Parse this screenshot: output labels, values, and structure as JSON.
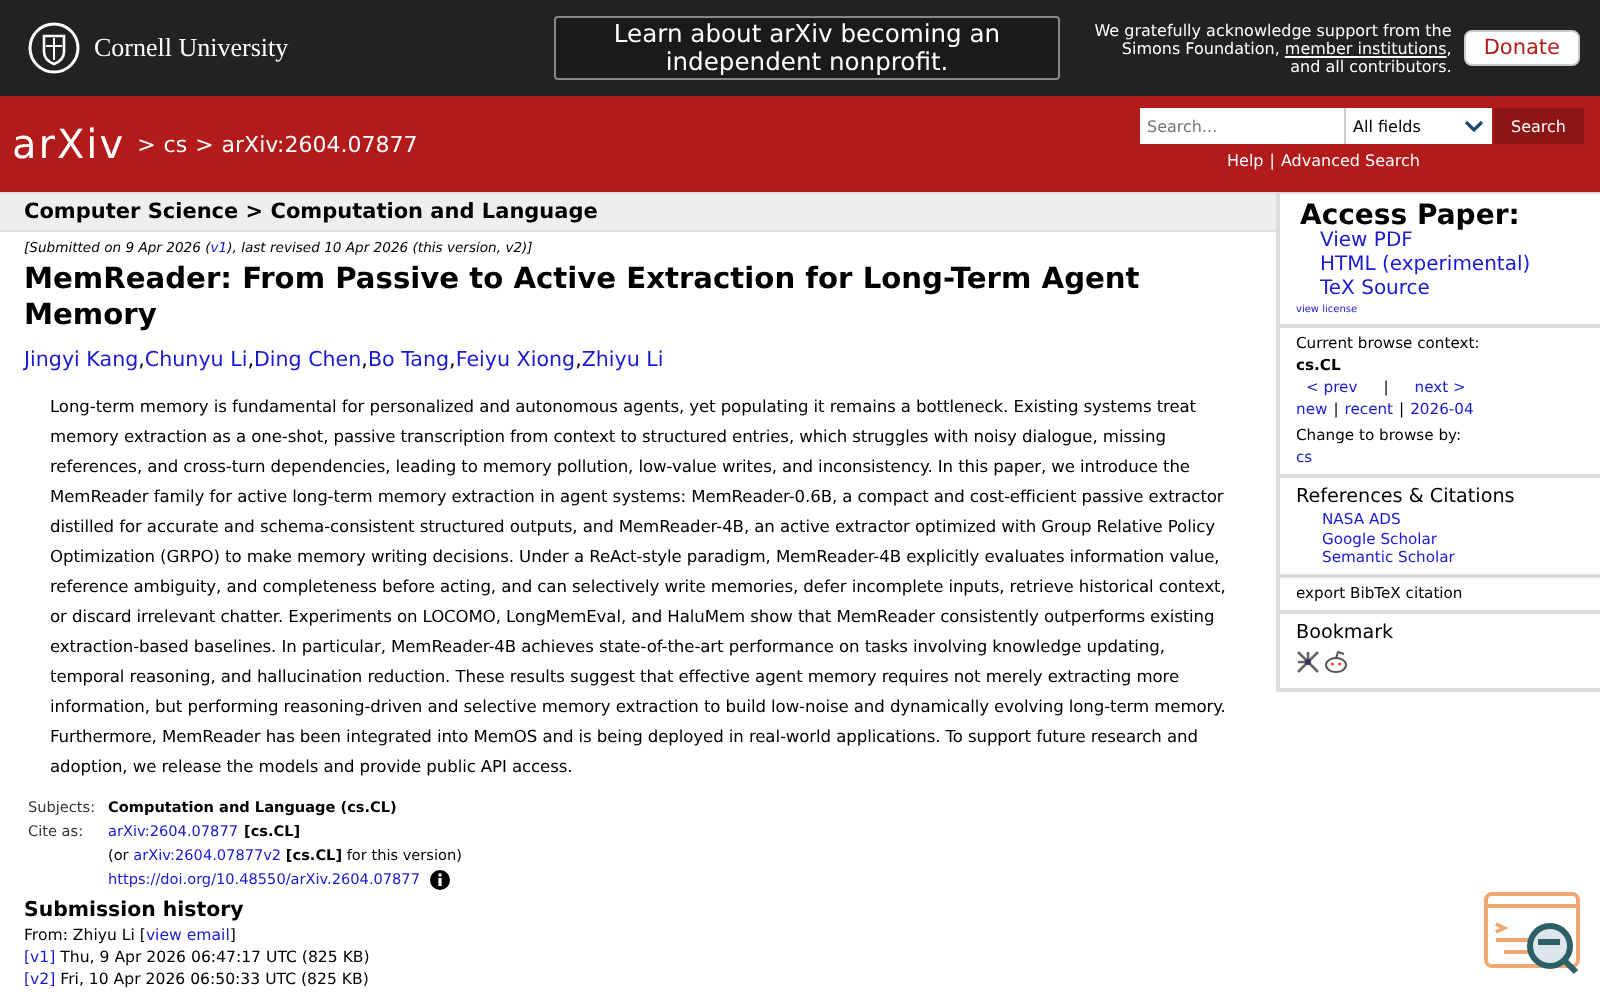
{
  "header": {
    "institution": "Cornell University",
    "banner": "Learn about arXiv becoming an independent nonprofit.",
    "support_before": "We gratefully acknowledge support from the Simons Foundation, ",
    "support_link": "member institutions",
    "support_after": ", and all contributors.",
    "donate": "Donate"
  },
  "nav": {
    "logo": "arXiv",
    "crumbs": [
      {
        "sep": ">",
        "label": "cs"
      },
      {
        "sep": ">",
        "label": "arXiv:2604.07877"
      }
    ],
    "search": {
      "placeholder": "Search...",
      "field": "All fields",
      "button": "Search"
    },
    "links": [
      "Help",
      "Advanced Search"
    ],
    "link_separator": "|"
  },
  "main": {
    "subject_header": "Computer Science > Computation and Language",
    "dateline": {
      "before": "[Submitted on 9 Apr 2026 (",
      "link": "v1",
      "after": "), last revised 10 Apr 2026 (this version, v2)]"
    },
    "title": "MemReader: From Passive to Active Extraction for Long-Term Agent Memory",
    "authors": [
      {
        "name": "Jingyi Kang",
        "sep": ","
      },
      {
        "name": "Chunyu Li",
        "sep": ","
      },
      {
        "name": "Ding Chen",
        "sep": ","
      },
      {
        "name": "Bo Tang",
        "sep": ","
      },
      {
        "name": "Feiyu Xiong",
        "sep": ","
      },
      {
        "name": "Zhiyu Li"
      }
    ],
    "abstract": "Long-term memory is fundamental for personalized and autonomous agents, yet populating it remains a bottleneck. Existing systems treat memory extraction as a one-shot, passive transcription from context to structured entries, which struggles with noisy dialogue, missing references, and cross-turn dependencies, leading to memory pollution, low-value writes, and inconsistency. In this paper, we introduce the MemReader family for active long-term memory extraction in agent systems: MemReader-0.6B, a compact and cost-efficient passive extractor distilled for accurate and schema-consistent structured outputs, and MemReader-4B, an active extractor optimized with Group Relative Policy Optimization (GRPO) to make memory writing decisions. Under a ReAct-style paradigm, MemReader-4B explicitly evaluates information value, reference ambiguity, and completeness before acting, and can selectively write memories, defer incomplete inputs, retrieve historical context, or discard irrelevant chatter. Experiments on LOCOMO, LongMemEval, and HaluMem show that MemReader consistently outperforms existing extraction-based baselines. In particular, MemReader-4B achieves state-of-the-art performance on tasks involving knowledge updating, temporal reasoning, and hallucination reduction. These results suggest that effective agent memory requires not merely extracting more information, but performing reasoning-driven and selective memory extraction to build low-noise and dynamically evolving long-term memory. Furthermore, MemReader has been integrated into MemOS and is being deployed in real-world applications. To support future research and adoption, we release the models and provide public API access.",
    "subjects": {
      "label": "Subjects:",
      "value": "Computation and Language (cs.CL)"
    },
    "cite": {
      "label": "Cite as:",
      "id": "arXiv:2604.07877",
      "tag": "[cs.CL]",
      "alt_before": "(or ",
      "alt_id": "arXiv:2604.07877v2",
      "alt_tag": "[cs.CL]",
      "alt_after": " for this version)",
      "doi": "https://doi.org/10.48550/arXiv.2604.07877"
    },
    "history": {
      "heading": "Submission history",
      "from_before": "From: Zhiyu Li [",
      "from_link": "view email",
      "from_after": "]",
      "versions": [
        {
          "version": "[v1]",
          "text": "Thu, 9 Apr 2026 06:47:17 UTC (825 KB)"
        },
        {
          "version": "[v2]",
          "text": "Fri, 10 Apr 2026 06:50:33 UTC (825 KB)"
        }
      ]
    }
  },
  "sidebar": {
    "access": {
      "heading": "Access Paper:",
      "links": [
        "View PDF",
        "HTML (experimental)",
        "TeX Source"
      ],
      "license": "view license"
    },
    "browse": {
      "context_label": "Current browse context:",
      "context": "cs.CL",
      "pager": [
        {
          "kind": "link",
          "text": "< prev"
        },
        {
          "kind": "sep",
          "text": "|"
        },
        {
          "kind": "link",
          "text": "next >"
        }
      ],
      "links": [
        {
          "kind": "link",
          "text": "new"
        },
        {
          "kind": "sep",
          "text": "|"
        },
        {
          "kind": "link",
          "text": "recent"
        },
        {
          "kind": "sep",
          "text": "|"
        },
        {
          "kind": "link",
          "text": "2026-04"
        }
      ],
      "change_label": "Change to browse by:",
      "change_links": [
        "cs"
      ]
    },
    "refs": {
      "heading": "References & Citations",
      "links": [
        "NASA ADS",
        "Google Scholar",
        "Semantic Scholar"
      ]
    },
    "export": "export BibTeX citation",
    "bookmark": {
      "heading": "Bookmark"
    }
  }
}
